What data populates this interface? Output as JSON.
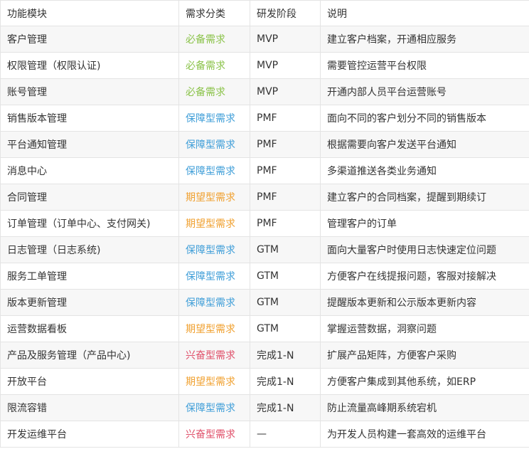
{
  "colors": {
    "必备需求": "#8bc34a",
    "保障型需求": "#3f9ed8",
    "期望型需求": "#f0a02f",
    "兴奋型需求": "#e0506a"
  },
  "headers": [
    "功能模块",
    "需求分类",
    "研发阶段",
    "说明"
  ],
  "rows": [
    {
      "module": "客户管理",
      "category": "必备需求",
      "stage": "MVP",
      "desc": "建立客户档案，开通相应服务"
    },
    {
      "module": "权限管理（权限认证)",
      "category": "必备需求",
      "stage": "MVP",
      "desc": "需要管控运营平台权限"
    },
    {
      "module": "账号管理",
      "category": "必备需求",
      "stage": "MVP",
      "desc": "开通内部人员平台运营账号"
    },
    {
      "module": "销售版本管理",
      "category": "保障型需求",
      "stage": "PMF",
      "desc": "面向不同的客户划分不同的销售版本"
    },
    {
      "module": "平台通知管理",
      "category": "保障型需求",
      "stage": "PMF",
      "desc": "根据需要向客户发送平台通知"
    },
    {
      "module": "消息中心",
      "category": "保障型需求",
      "stage": "PMF",
      "desc": "多渠道推送各类业务通知"
    },
    {
      "module": "合同管理",
      "category": "期望型需求",
      "stage": "PMF",
      "desc": "建立客户的合同档案，提醒到期续订"
    },
    {
      "module": "订单管理（订单中心、支付网关)",
      "category": "期望型需求",
      "stage": "PMF",
      "desc": "管理客户的订单"
    },
    {
      "module": "日志管理（日志系统)",
      "category": "保障型需求",
      "stage": "GTM",
      "desc": "面向大量客户时使用日志快速定位问题"
    },
    {
      "module": "服务工单管理",
      "category": "保障型需求",
      "stage": "GTM",
      "desc": "方便客户在线提报问题，客服对接解决"
    },
    {
      "module": "版本更新管理",
      "category": "保障型需求",
      "stage": "GTM",
      "desc": "提醒版本更新和公示版本更新内容"
    },
    {
      "module": "运营数据看板",
      "category": "期望型需求",
      "stage": "GTM",
      "desc": "掌握运营数据，洞察问题"
    },
    {
      "module": "产品及服务管理（产品中心)",
      "category": "兴奋型需求",
      "stage": "完成1-N",
      "desc": "扩展产品矩阵，方便客户采购"
    },
    {
      "module": "开放平台",
      "category": "期望型需求",
      "stage": "完成1-N",
      "desc": "方便客户集成到其他系统，如ERP"
    },
    {
      "module": "限流容错",
      "category": "保障型需求",
      "stage": "完成1-N",
      "desc": "防止流量高峰期系统宕机"
    },
    {
      "module": "开发运维平台",
      "category": "兴奋型需求",
      "stage": "—",
      "desc": "为开发人员构建一套高效的运维平台"
    }
  ]
}
